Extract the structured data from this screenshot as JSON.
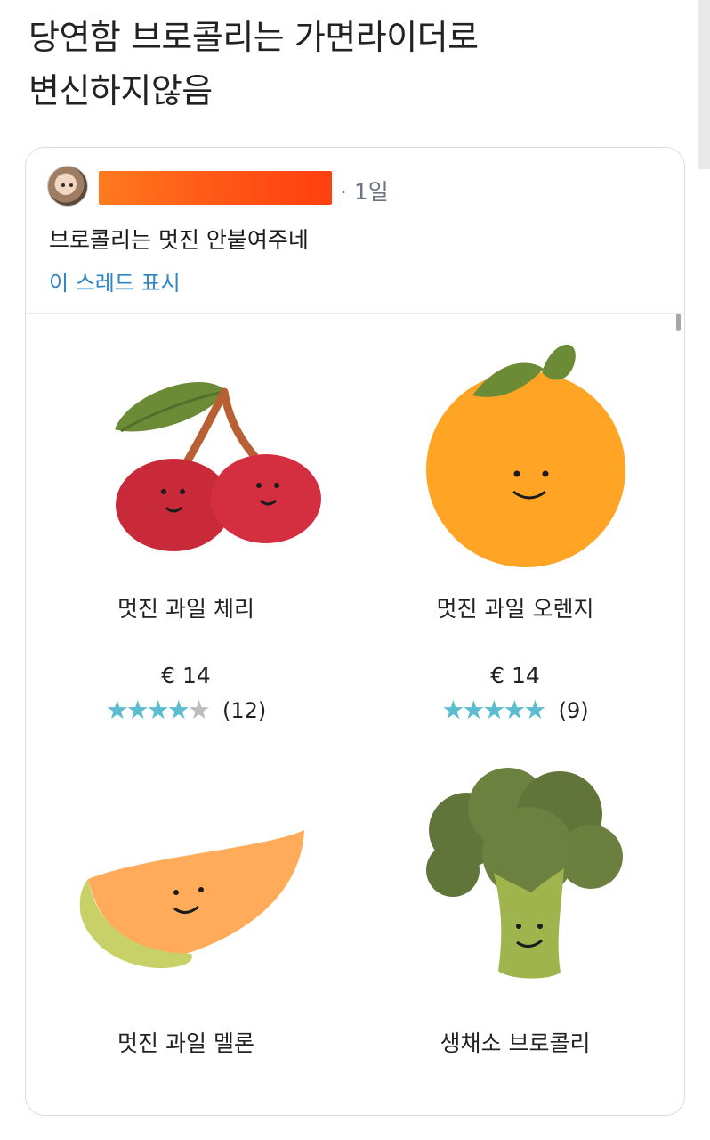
{
  "headline": {
    "line1": "당연함 브로콜리는 가면라이더로",
    "line2": "변신하지않음"
  },
  "tweet": {
    "time": "· 1일",
    "text": "브로콜리는 멋진 안붙여주네",
    "thread_link": "이 스레드 표시"
  },
  "products": [
    {
      "name": "멋진 과일 체리",
      "price": "€ 14",
      "rating": 4,
      "max_rating": 5,
      "review_count": "(12)",
      "image_icon": "cherry-plush-icon"
    },
    {
      "name": "멋진 과일 오렌지",
      "price": "€ 14",
      "rating": 5,
      "max_rating": 5,
      "review_count": "(9)",
      "image_icon": "orange-plush-icon"
    },
    {
      "name": "멋진 과일 멜론",
      "image_icon": "melon-plush-icon"
    },
    {
      "name": "생채소 브로콜리",
      "image_icon": "broccoli-plush-icon"
    }
  ],
  "colors": {
    "link": "#2f86c5",
    "star": "#5cbdd1",
    "empty_star": "#bdbdbd",
    "redaction": "#ff5b17"
  }
}
